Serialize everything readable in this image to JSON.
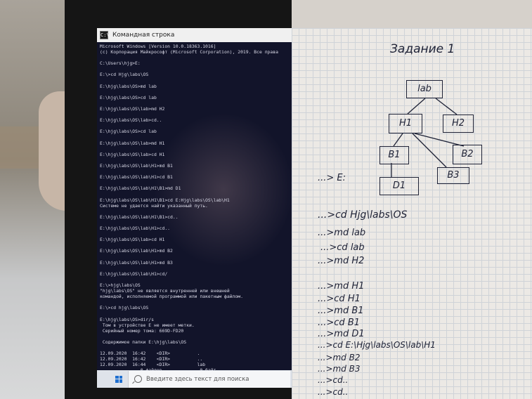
{
  "window": {
    "title": "Командная строка",
    "icon": "cmd-icon"
  },
  "console_lines": [
    "Microsoft Windows [Version 10.0.18363.1016]",
    "(c) Корпорация Майкрософт (Microsoft Corporation), 2019. Все права",
    "",
    "C:\\Users\\hjg>E:",
    "",
    "E:\\>cd Hjg\\labs\\OS",
    "",
    "E:\\hjg\\labs\\OS>md lab",
    "",
    "E:\\hjg\\labs\\OS>cd lab",
    "",
    "E:\\hjg\\labs\\OS\\lab>md H2",
    "",
    "E:\\hjg\\labs\\OS\\lab>cd..",
    "",
    "E:\\hjg\\labs\\OS>cd lab",
    "",
    "E:\\hjg\\labs\\OS\\lab>md H1",
    "",
    "E:\\hjg\\labs\\OS\\lab>cd H1",
    "",
    "E:\\hjg\\labs\\OS\\lab\\H1>md B1",
    "",
    "E:\\hjg\\labs\\OS\\lab\\H1>cd B1",
    "",
    "E:\\hjg\\labs\\OS\\lab\\H1\\B1>md D1",
    "",
    "E:\\hjg\\labs\\OS\\lab\\H1\\B1>cd E:Hjg\\labs\\OS\\lab\\H1",
    "Системе не удается найти указанный путь.",
    "",
    "E:\\hjg\\labs\\OS\\lab\\H1\\B1>cd..",
    "",
    "E:\\hjg\\labs\\OS\\lab\\H1>cd..",
    "",
    "E:\\hjg\\labs\\OS\\lab>cd H1",
    "",
    "E:\\hjg\\labs\\OS\\lab\\H1>md B2",
    "",
    "E:\\hjg\\labs\\OS\\lab\\H1>md B3",
    "",
    "E:\\hjg\\labs\\OS\\lab\\H1>cd/",
    "",
    "E:\\>hjg\\labs\\OS",
    "\"hjg\\labs\\OS\" не является внутренней или внешней",
    "командой, исполняемой программой или пакетным файлом.",
    "",
    "E:\\>cd hjg\\labs\\OS",
    "",
    "E:\\hjg\\labs\\OS>dir/s",
    " Том в устройстве E не имеет метки.",
    " Серийный номер тома: 669D-FD20",
    "",
    " Содержимое папки E:\\hjg\\labs\\OS",
    "",
    "12.09.2020  16:42    <DIR>          .",
    "12.09.2020  16:42    <DIR>          ..",
    "12.09.2020  16:44    <DIR>          lab",
    "               0 файлов              0 байт"
  ],
  "taskbar": {
    "search_placeholder": "Введите здесь текст для поиска"
  },
  "notebook": {
    "heading": "Задание 1",
    "tree_nodes": [
      "lab",
      "H1",
      "H2",
      "B1",
      "B2",
      "B3",
      "D1"
    ],
    "lines": [
      "...> E:",
      "...>cd Hjg\\labs\\OS",
      "...>md lab",
      "...>cd lab",
      "...>md H2",
      "...>md H1",
      "...>cd H1",
      "...>md B1",
      "...>cd B1",
      "...>md D1",
      "...>cd E:\\Hjg\\labs\\OS\\lab\\H1",
      "...>md B2",
      "...>md B3",
      "...>cd..",
      "...>cd.."
    ]
  }
}
